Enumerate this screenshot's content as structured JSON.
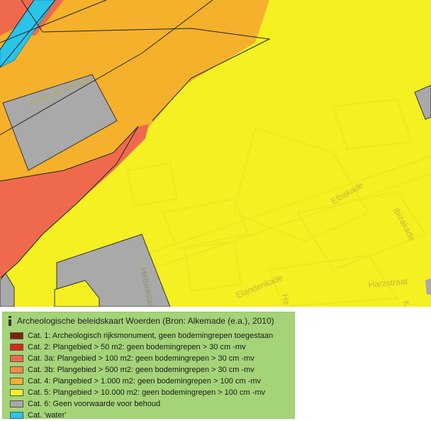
{
  "map": {
    "streets": [
      {
        "id": "johan-de-wittlaan",
        "label": "Johan de Wittlaan"
      },
      {
        "id": "elbakade",
        "label": "Elbakade"
      },
      {
        "id": "ibizakade",
        "label": "Ibizakade"
      },
      {
        "id": "harzstraat",
        "label": "Harzstraat"
      },
      {
        "id": "helsinkilaan",
        "label": "Helsinkilaan"
      },
      {
        "id": "elandenkade",
        "label": "Elandenkade"
      },
      {
        "id": "he",
        "label": "He"
      },
      {
        "id": "ka",
        "label": "Ka"
      }
    ]
  },
  "legend": {
    "icon": "info-icon",
    "title": "Archeologische beleidskaart Woerden (Bron: Alkemade (e.a.), 2010)",
    "items": [
      {
        "label": "Cat. 1: Archeologisch rijksmonument, geen bodemingrepen toegestaan",
        "color": "#7a2311"
      },
      {
        "label": "Cat. 2: Plangebied > 50 m2: geen bodemingrepen > 30 cm -mv",
        "color": "#d52a1c"
      },
      {
        "label": "Cat. 3a: Plangebied > 100 m2: geen bodemingrepen > 30 cm -mv",
        "color": "#ef6a4d"
      },
      {
        "label": "Cat. 3b: Plangebied > 500 m2: geen bodemingrepen > 30 cm -mv",
        "color": "#f58a49"
      },
      {
        "label": "Cat. 4: Plangebied > 1.000 m2: geen bodemingrepen > 100 cm -mv",
        "color": "#f5b030"
      },
      {
        "label": "Cat. 5: Plangebied > 10.000 m2: geen bodemingrepen > 100 cm -mv",
        "color": "#f5f225"
      },
      {
        "label": "Cat. 6: Geen voorwaarde voor behoud",
        "color": "#a9a9a9"
      },
      {
        "label": "Cat. 'water'",
        "color": "#2bc4e9"
      }
    ]
  }
}
